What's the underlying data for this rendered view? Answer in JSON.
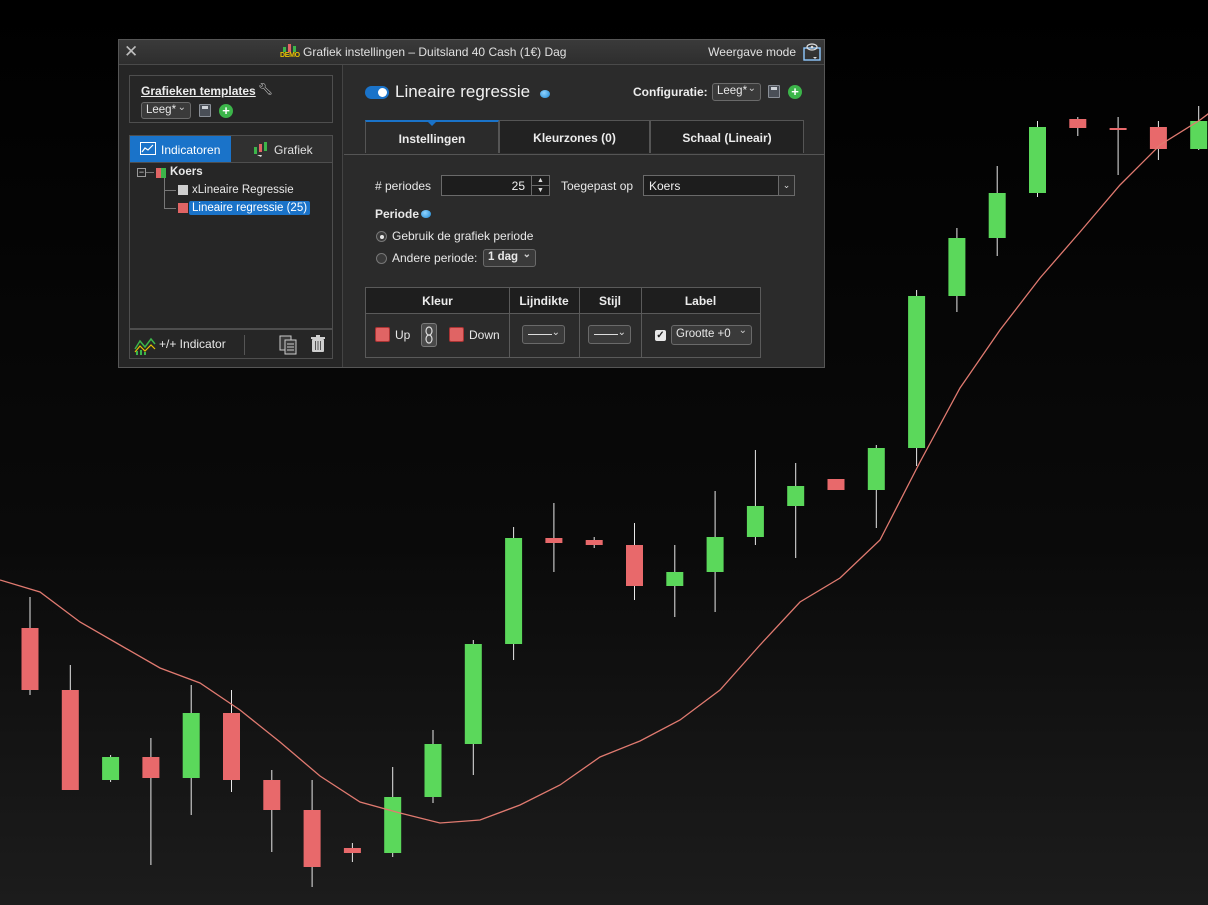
{
  "dialog": {
    "title": "Grafiek instellingen – Duitsland 40 Cash (1€) Dag",
    "badge": "DEMO",
    "mode_label": "Weergave mode"
  },
  "templates": {
    "title": "Grafieken templates",
    "selected": "Leeg*"
  },
  "left_tabs": {
    "indicators": "Indicatoren",
    "chart": "Grafiek"
  },
  "tree": {
    "root": "Koers",
    "items": [
      "xLineaire Regressie",
      "Lineaire regressie (25)"
    ]
  },
  "footer": {
    "add_indicator": "+/+ Indicator"
  },
  "indicator": {
    "title": "Lineaire regressie",
    "config_label": "Configuratie:",
    "config_value": "Leeg*"
  },
  "tabs": [
    "Instellingen",
    "Kleurzones (0)",
    "Schaal (Lineair)"
  ],
  "settings": {
    "periods_label": "# periodes",
    "periods_value": "25",
    "applied_label": "Toegepast op",
    "applied_value": "Koers",
    "period_heading": "Periode",
    "radio_chart": "Gebruik de grafiek periode",
    "radio_other": "Andere periode:",
    "other_value": "1 dag"
  },
  "color_table": {
    "headers": [
      "Kleur",
      "Lijndikte",
      "Stijl",
      "Label"
    ],
    "up": "Up",
    "down": "Down",
    "label_value": "Grootte +0"
  },
  "colors": {
    "up": "#5bd85b",
    "down": "#e8696b",
    "accent": "#1a73c9",
    "regression": "#e07a70"
  },
  "chart_data": {
    "type": "candlestick",
    "note_units": "relative price units (no axis labels visible)",
    "candles": [
      {
        "o": 628,
        "h": 597,
        "l": 695,
        "c": 690
      },
      {
        "o": 690,
        "h": 665,
        "l": 790,
        "c": 790
      },
      {
        "o": 780,
        "h": 755,
        "l": 782,
        "c": 757
      },
      {
        "o": 757,
        "h": 738,
        "l": 865,
        "c": 778
      },
      {
        "o": 778,
        "h": 685,
        "l": 815,
        "c": 713
      },
      {
        "o": 713,
        "h": 690,
        "l": 792,
        "c": 780
      },
      {
        "o": 780,
        "h": 770,
        "l": 852,
        "c": 810
      },
      {
        "o": 810,
        "h": 780,
        "l": 887,
        "c": 867
      },
      {
        "o": 848,
        "h": 843,
        "l": 862,
        "c": 853
      },
      {
        "o": 853,
        "h": 767,
        "l": 857,
        "c": 797
      },
      {
        "o": 797,
        "h": 730,
        "l": 803,
        "c": 744
      },
      {
        "o": 744,
        "h": 640,
        "l": 775,
        "c": 644
      },
      {
        "o": 644,
        "h": 527,
        "l": 660,
        "c": 538
      },
      {
        "o": 538,
        "h": 503,
        "l": 572,
        "c": 543
      },
      {
        "o": 540,
        "h": 537,
        "l": 548,
        "c": 545
      },
      {
        "o": 545,
        "h": 523,
        "l": 600,
        "c": 586
      },
      {
        "o": 586,
        "h": 545,
        "l": 617,
        "c": 572
      },
      {
        "o": 572,
        "h": 491,
        "l": 612,
        "c": 537
      },
      {
        "o": 537,
        "h": 450,
        "l": 545,
        "c": 506
      },
      {
        "o": 506,
        "h": 463,
        "l": 558,
        "c": 486
      },
      {
        "o": 479,
        "h": 479,
        "l": 490,
        "c": 490
      },
      {
        "o": 490,
        "h": 445,
        "l": 528,
        "c": 448
      },
      {
        "o": 448,
        "h": 290,
        "l": 466,
        "c": 296
      },
      {
        "o": 296,
        "h": 228,
        "l": 312,
        "c": 238
      },
      {
        "o": 238,
        "h": 166,
        "l": 256,
        "c": 193
      },
      {
        "o": 193,
        "h": 121,
        "l": 197,
        "c": 127
      },
      {
        "o": 119,
        "h": 117,
        "l": 136,
        "c": 128
      },
      {
        "o": 128,
        "h": 117,
        "l": 175,
        "c": 128
      },
      {
        "o": 127,
        "h": 121,
        "l": 160,
        "c": 149
      },
      {
        "o": 149,
        "h": 106,
        "l": 150,
        "c": 121
      }
    ],
    "regression_line": [
      580,
      592,
      622,
      645,
      668,
      683,
      710,
      742,
      776,
      802,
      813,
      823,
      820,
      805,
      785,
      757,
      741,
      720,
      690,
      645,
      602,
      578,
      540,
      462,
      388,
      330,
      278,
      232,
      185,
      145,
      120,
      90
    ]
  }
}
